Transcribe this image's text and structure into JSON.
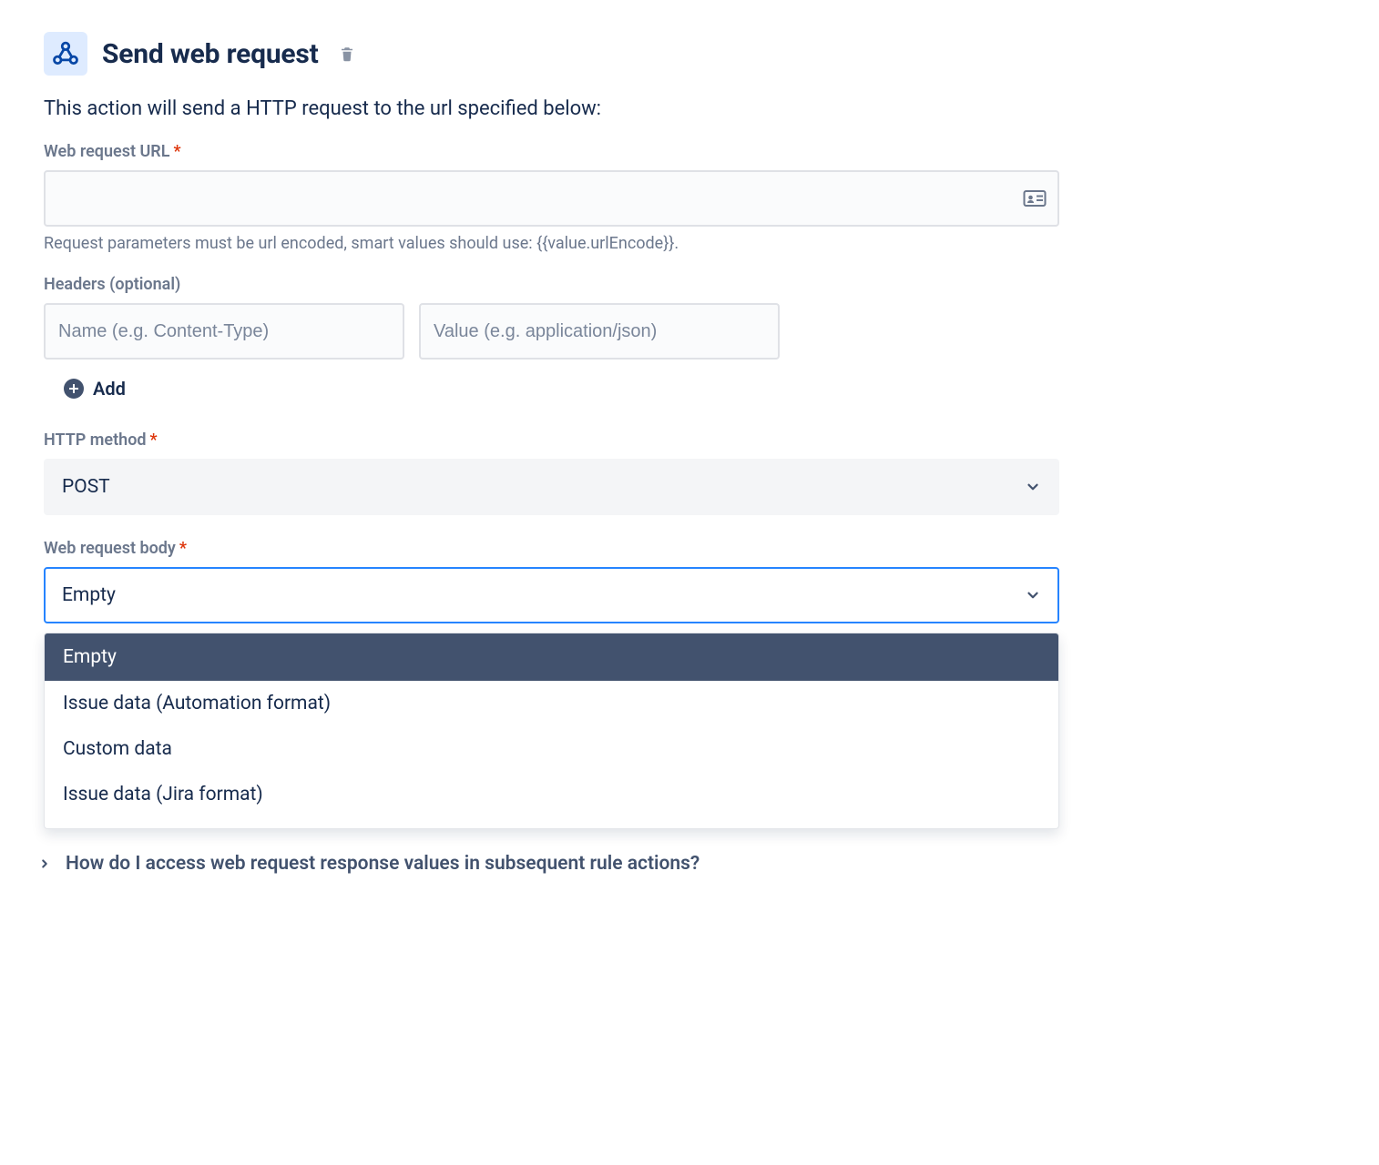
{
  "header": {
    "title": "Send web request"
  },
  "description": "This action will send a HTTP request to the url specified below:",
  "url_field": {
    "label": "Web request URL",
    "required": "*",
    "value": "",
    "help": "Request parameters must be url encoded, smart values should use: {{value.urlEncode}}."
  },
  "headers_section": {
    "label": "Headers (optional)",
    "name_placeholder": "Name (e.g. Content-Type)",
    "value_placeholder": "Value (e.g. application/json)",
    "name_value": "",
    "value_value": "",
    "add_label": "Add"
  },
  "http_method": {
    "label": "HTTP method",
    "required": "*",
    "selected": "POST"
  },
  "body": {
    "label": "Web request body",
    "required": "*",
    "selected": "Empty",
    "options": [
      "Empty",
      "Issue data (Automation format)",
      "Custom data",
      "Issue data (Jira format)"
    ]
  },
  "expand_help": "How do I access web request response values in subsequent rule actions?"
}
